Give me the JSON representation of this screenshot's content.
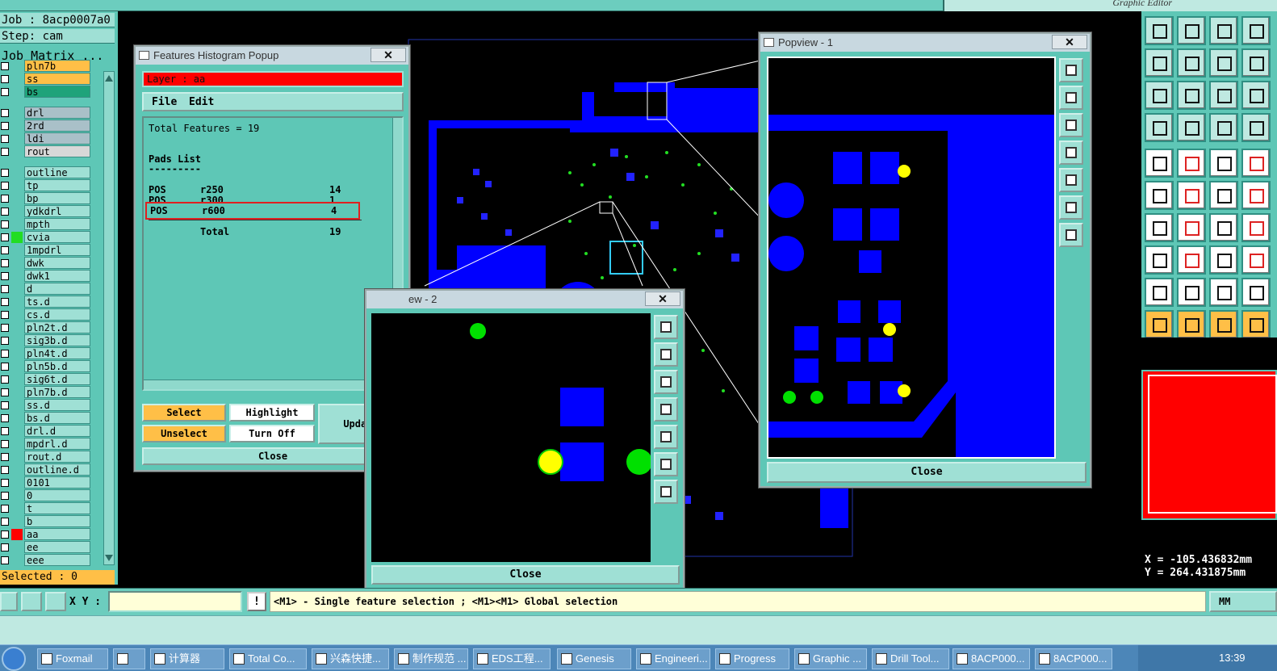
{
  "top": {
    "app_title": "Graphic Editor"
  },
  "left_panel": {
    "job_label": "Job : 8acp0007a0",
    "step_label": "Step: cam",
    "job_matrix_label": "Job Matrix ...",
    "selected_label": "Selected : 0",
    "layers": [
      {
        "name": "pln7b",
        "color": "#ffbf47"
      },
      {
        "name": "ss",
        "color": "#ffbf47"
      },
      {
        "name": "bs",
        "color": "#1fa37a"
      },
      {
        "name": "drl",
        "color": "#a9c0c8"
      },
      {
        "name": "2rd",
        "color": "#a9c0c8"
      },
      {
        "name": "ldi",
        "color": "#a9c0c8"
      },
      {
        "name": "rout",
        "color": "#d8d8d8"
      },
      {
        "name": "outline",
        "color": "#9fe0d5"
      },
      {
        "name": "tp",
        "color": "#9fe0d5"
      },
      {
        "name": "bp",
        "color": "#9fe0d5"
      },
      {
        "name": "ydkdrl",
        "color": "#9fe0d5"
      },
      {
        "name": "mpth",
        "color": "#9fe0d5"
      },
      {
        "name": "cvia",
        "color": "#9fe0d5",
        "swatch": "#22dd22"
      },
      {
        "name": "1mpdrl",
        "color": "#9fe0d5"
      },
      {
        "name": "dwk",
        "color": "#9fe0d5"
      },
      {
        "name": "dwk1",
        "color": "#9fe0d5"
      },
      {
        "name": "d",
        "color": "#9fe0d5"
      },
      {
        "name": "ts.d",
        "color": "#9fe0d5"
      },
      {
        "name": "cs.d",
        "color": "#9fe0d5"
      },
      {
        "name": "pln2t.d",
        "color": "#9fe0d5"
      },
      {
        "name": "sig3b.d",
        "color": "#9fe0d5"
      },
      {
        "name": "pln4t.d",
        "color": "#9fe0d5"
      },
      {
        "name": "pln5b.d",
        "color": "#9fe0d5"
      },
      {
        "name": "sig6t.d",
        "color": "#9fe0d5"
      },
      {
        "name": "pln7b.d",
        "color": "#9fe0d5"
      },
      {
        "name": "ss.d",
        "color": "#9fe0d5"
      },
      {
        "name": "bs.d",
        "color": "#9fe0d5"
      },
      {
        "name": "drl.d",
        "color": "#9fe0d5"
      },
      {
        "name": "mpdrl.d",
        "color": "#9fe0d5"
      },
      {
        "name": "rout.d",
        "color": "#9fe0d5"
      },
      {
        "name": "outline.d",
        "color": "#9fe0d5"
      },
      {
        "name": "0101",
        "color": "#9fe0d5"
      },
      {
        "name": "0",
        "color": "#9fe0d5"
      },
      {
        "name": "t",
        "color": "#9fe0d5"
      },
      {
        "name": "b",
        "color": "#9fe0d5"
      },
      {
        "name": "aa",
        "color": "#9fe0d5",
        "swatch": "#ff0000",
        "active": true
      },
      {
        "name": "ee",
        "color": "#9fe0d5"
      },
      {
        "name": "eee",
        "color": "#9fe0d5"
      }
    ]
  },
  "histogram": {
    "title": "Features Histogram Popup",
    "layer_label": "Layer :  aa",
    "menu": [
      "File",
      "Edit"
    ],
    "total_line": "Total Features = 19",
    "list_title": "Pads List",
    "list_underline": "---------",
    "rows": [
      {
        "type": "POS",
        "sym": "r250",
        "count": "14"
      },
      {
        "type": "POS",
        "sym": "r300",
        "count": "1"
      },
      {
        "type": "POS",
        "sym": "r600",
        "count": "4"
      }
    ],
    "total_label": "Total",
    "total_value": "19",
    "select_label": "Select",
    "unselect_label": "Unselect",
    "highlight_label": "Highlight",
    "turnoff_label": "Turn Off",
    "update_label": "Update",
    "close_label": "Close"
  },
  "popview1": {
    "title": "Popview - 1",
    "close_label": "Close"
  },
  "popview2": {
    "title": "ew - 2",
    "close_label": "Close"
  },
  "coords": {
    "x": "X = -105.436832mm",
    "y": "Y = 264.431875mm"
  },
  "command": {
    "xy_label": "X Y :",
    "xy_value": "",
    "hint": "<M1> - Single feature selection ; <M1><M1> Global selection",
    "units": "MM"
  },
  "taskbar": {
    "items": [
      "Foxmail",
      "",
      "计算器",
      "Total Co...",
      "兴森快捷...",
      "制作规范 ...",
      "EDS工程...",
      "Genesis",
      "Engineeri...",
      "Progress",
      "Graphic ...",
      "Drill Tool...",
      "8ACP000...",
      "8ACP000..."
    ],
    "clock": "13:39"
  },
  "colors": {
    "panel": "#5ec7b6",
    "button": "#9fe0d5",
    "orange": "#ffbf47",
    "copper": "#0000ff",
    "pad_green": "#00e000",
    "pad_yellow": "#ffff00",
    "layer_red": "#ff0000"
  },
  "icons": [
    "window-icon",
    "close-icon",
    "checkbox-icon",
    "tool-icon",
    "start-orb-icon"
  ]
}
